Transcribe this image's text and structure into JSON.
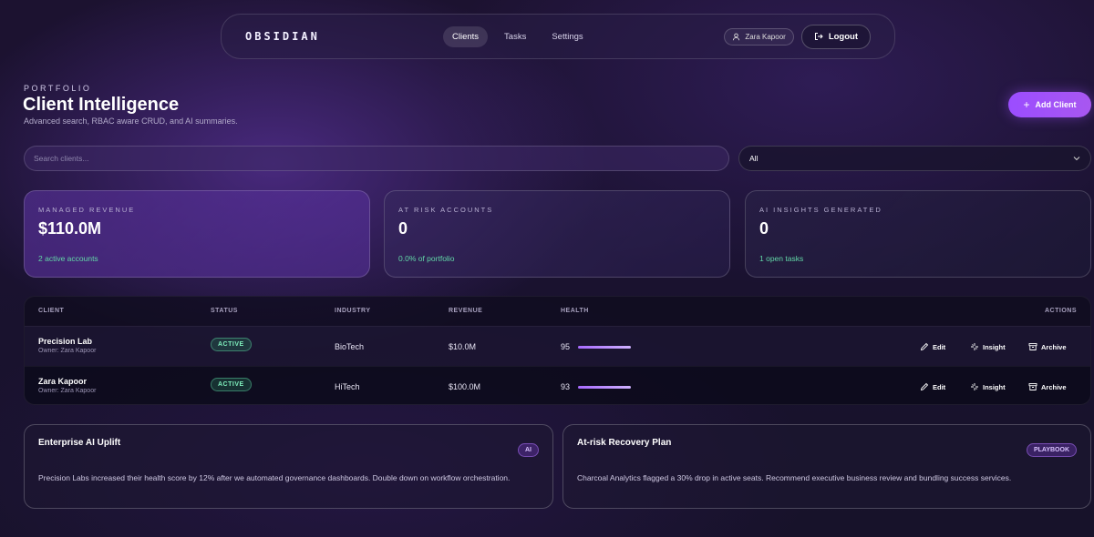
{
  "nav": {
    "brand": "OBSIDIAN",
    "links": [
      "Clients",
      "Tasks",
      "Settings"
    ],
    "user": "Zara Kapoor",
    "logout": "Logout"
  },
  "header": {
    "eyebrow": "PORTFOLIO",
    "title": "Client Intelligence",
    "subtitle": "Advanced search, RBAC aware CRUD, and AI summaries.",
    "add_button": "Add Client"
  },
  "search": {
    "placeholder": "Search clients..."
  },
  "filter": {
    "selected": "All"
  },
  "stats": [
    {
      "label": "MANAGED REVENUE",
      "value": "$110.0M",
      "sub": "2 active accounts"
    },
    {
      "label": "AT RISK ACCOUNTS",
      "value": "0",
      "sub": "0.0% of portfolio"
    },
    {
      "label": "AI INSIGHTS GENERATED",
      "value": "0",
      "sub": "1 open tasks"
    }
  ],
  "table": {
    "headers": [
      "CLIENT",
      "STATUS",
      "INDUSTRY",
      "REVENUE",
      "HEALTH",
      "ACTIONS"
    ],
    "rows": [
      {
        "name": "Precision Lab",
        "owner": "Owner: Zara Kapoor",
        "status": "ACTIVE",
        "industry": "BioTech",
        "revenue": "$10.0M",
        "health": "95"
      },
      {
        "name": "Zara Kapoor",
        "owner": "Owner: Zara Kapoor",
        "status": "ACTIVE",
        "industry": "HiTech",
        "revenue": "$100.0M",
        "health": "93"
      }
    ],
    "actions": [
      "Edit",
      "Insight",
      "Archive"
    ]
  },
  "cards": [
    {
      "title": "Enterprise AI Uplift",
      "tag": "AI",
      "body": "Precision Labs increased their health score by 12% after we automated governance dashboards. Double down on workflow orchestration."
    },
    {
      "title": "At-risk Recovery Plan",
      "tag": "PLAYBOOK",
      "body": "Charcoal Analytics flagged a 30% drop in active seats. Recommend executive business review and bundling success services."
    }
  ],
  "colors": {
    "accent": "#9b4dff",
    "positive": "#62d6a7"
  }
}
